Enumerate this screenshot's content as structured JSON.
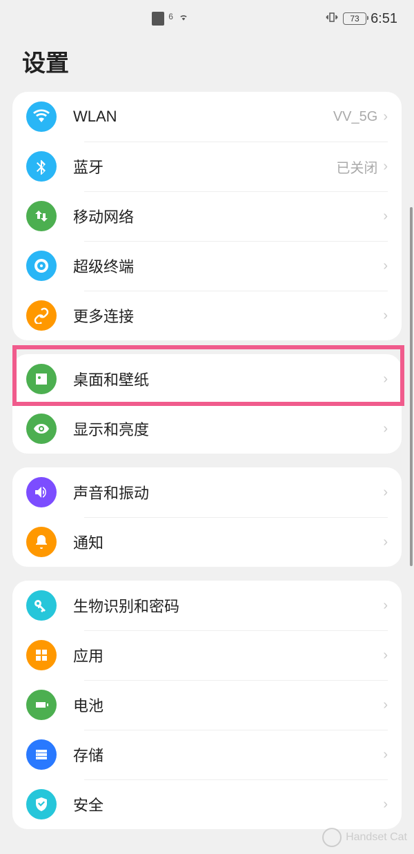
{
  "status": {
    "wifi_label": "6",
    "battery": "73",
    "time": "6:51"
  },
  "page": {
    "title": "设置"
  },
  "groups": [
    {
      "items": [
        {
          "id": "wlan",
          "label": "WLAN",
          "value": "VV_5G",
          "icon": "wifi",
          "color": "#29b6f6"
        },
        {
          "id": "bluetooth",
          "label": "蓝牙",
          "value": "已关闭",
          "icon": "bluetooth",
          "color": "#29b6f6"
        },
        {
          "id": "mobile",
          "label": "移动网络",
          "value": "",
          "icon": "arrows",
          "color": "#4caf50"
        },
        {
          "id": "super",
          "label": "超级终端",
          "value": "",
          "icon": "target",
          "color": "#29b6f6"
        },
        {
          "id": "more",
          "label": "更多连接",
          "value": "",
          "icon": "link",
          "color": "#ff9800"
        }
      ]
    },
    {
      "items": [
        {
          "id": "wallpaper",
          "label": "桌面和壁纸",
          "value": "",
          "icon": "image",
          "color": "#4caf50"
        },
        {
          "id": "display",
          "label": "显示和亮度",
          "value": "",
          "icon": "eye",
          "color": "#4caf50"
        }
      ]
    },
    {
      "items": [
        {
          "id": "sound",
          "label": "声音和振动",
          "value": "",
          "icon": "volume",
          "color": "#7c4dff"
        },
        {
          "id": "notify",
          "label": "通知",
          "value": "",
          "icon": "bell",
          "color": "#ff9800"
        }
      ]
    },
    {
      "items": [
        {
          "id": "biometric",
          "label": "生物识别和密码",
          "value": "",
          "icon": "key",
          "color": "#26c6da"
        },
        {
          "id": "apps",
          "label": "应用",
          "value": "",
          "icon": "grid",
          "color": "#ff9800"
        },
        {
          "id": "battery",
          "label": "电池",
          "value": "",
          "icon": "battery",
          "color": "#4caf50"
        },
        {
          "id": "storage",
          "label": "存储",
          "value": "",
          "icon": "storage",
          "color": "#2979ff"
        },
        {
          "id": "security",
          "label": "安全",
          "value": "",
          "icon": "shield",
          "color": "#26c6da"
        }
      ]
    }
  ],
  "watermark": {
    "text": "Handset Cat"
  }
}
